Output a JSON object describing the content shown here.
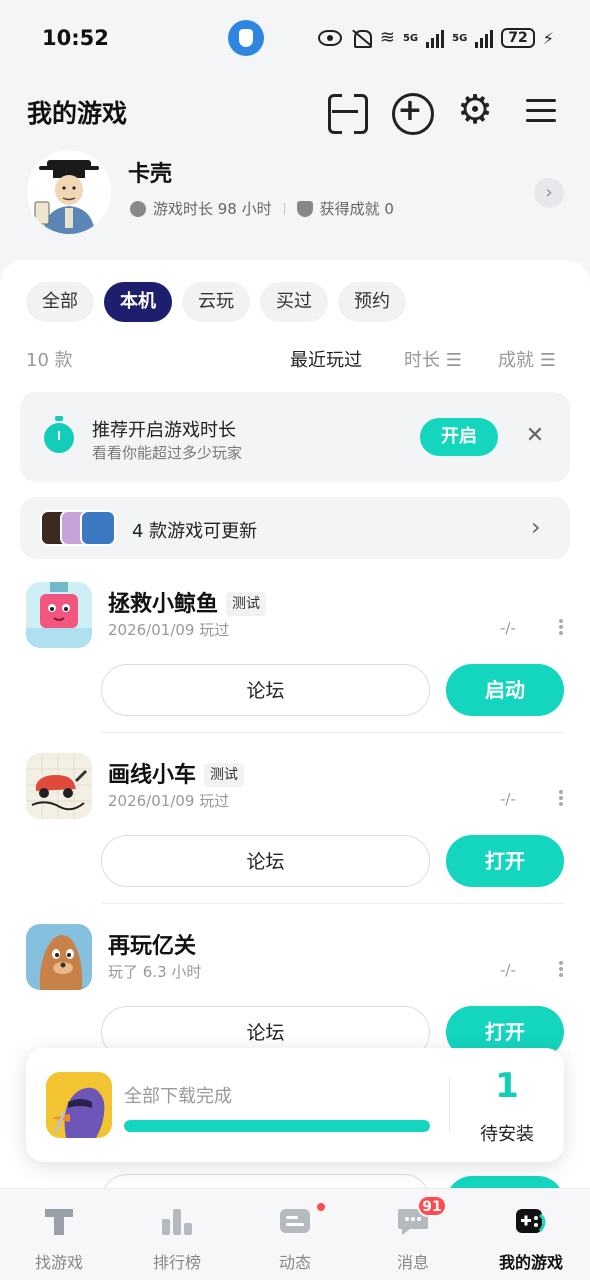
{
  "status_bar": {
    "time": "10:52",
    "battery": "72",
    "signal_labels": [
      "5G",
      "5G"
    ]
  },
  "header": {
    "title": "我的游戏",
    "icons": [
      "scan-icon",
      "add-circle-icon",
      "gear-icon",
      "menu-icon"
    ]
  },
  "profile": {
    "name": "卡壳",
    "playtime": "游戏时长 98 小时",
    "achievements": "获得成就 0"
  },
  "tabs": [
    {
      "label": "全部",
      "active": false
    },
    {
      "label": "本机",
      "active": true
    },
    {
      "label": "云玩",
      "active": false
    },
    {
      "label": "买过",
      "active": false
    },
    {
      "label": "预约",
      "active": false
    }
  ],
  "list_header": {
    "count": "10 款",
    "sorts": [
      "最近玩过",
      "时长",
      "成就"
    ]
  },
  "banner": {
    "title": "推荐开启游戏时长",
    "subtitle": "看看你能超过多少玩家",
    "button": "开启"
  },
  "update_bar": {
    "text": "4 款游戏可更新"
  },
  "games": [
    {
      "name": "拯救小鲸鱼",
      "tag": "测试",
      "meta": "2026/01/09 玩过",
      "dash": "-/-",
      "forum": "论坛",
      "action": "启动"
    },
    {
      "name": "画线小车",
      "tag": "测试",
      "meta": "2026/01/09 玩过",
      "dash": "-/-",
      "forum": "论坛",
      "action": "打开"
    },
    {
      "name": "再玩亿关",
      "tag": "",
      "meta": "玩了 6.3 小时",
      "dash": "-/-",
      "forum": "论坛",
      "action": "打开"
    }
  ],
  "download": {
    "status": "全部下载完成",
    "progress": 1.0,
    "count": "1",
    "count_label": "待安装"
  },
  "bottom_nav": [
    {
      "label": "找游戏",
      "icon": "find-games-icon",
      "active": false
    },
    {
      "label": "排行榜",
      "icon": "leaderboard-icon",
      "active": false
    },
    {
      "label": "动态",
      "icon": "feed-icon",
      "active": false
    },
    {
      "label": "消息",
      "icon": "message-icon",
      "active": false,
      "badge": "91"
    },
    {
      "label": "我的游戏",
      "icon": "my-games-icon",
      "active": true
    }
  ],
  "colors": {
    "accent": "#14d5be",
    "tab_active": "#1d1e6e",
    "badge": "#ff4d4f"
  }
}
